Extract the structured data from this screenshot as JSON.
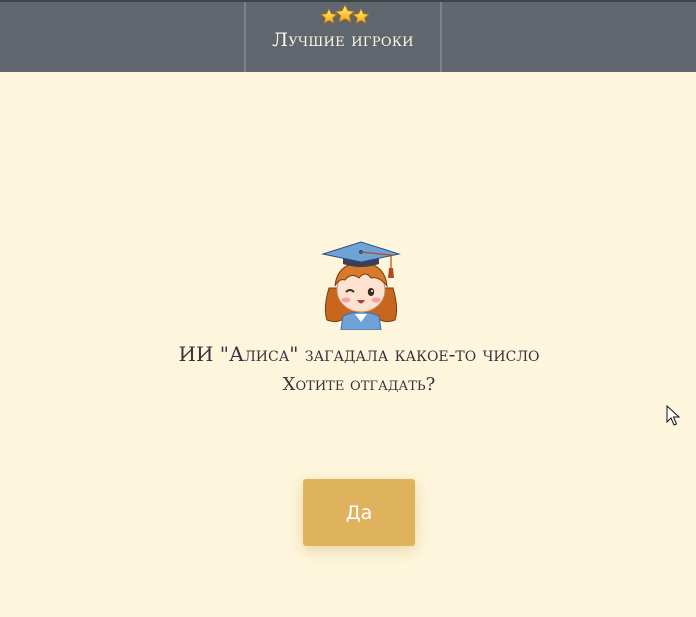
{
  "header": {
    "leaders_label": "Лучшие игроки",
    "leaders_icon": "three-stars-icon"
  },
  "main": {
    "mascot_icon": "graduate-girl-icon",
    "message_line1": "ИИ \"Алиса\" загадала какое-то число",
    "message_line2": "Хотите отгадать?",
    "yes_label": "Да"
  },
  "colors": {
    "background": "#fdf6dc",
    "topbar": "#5f666d",
    "button": "#dfb25e",
    "text": "#3d3140"
  }
}
